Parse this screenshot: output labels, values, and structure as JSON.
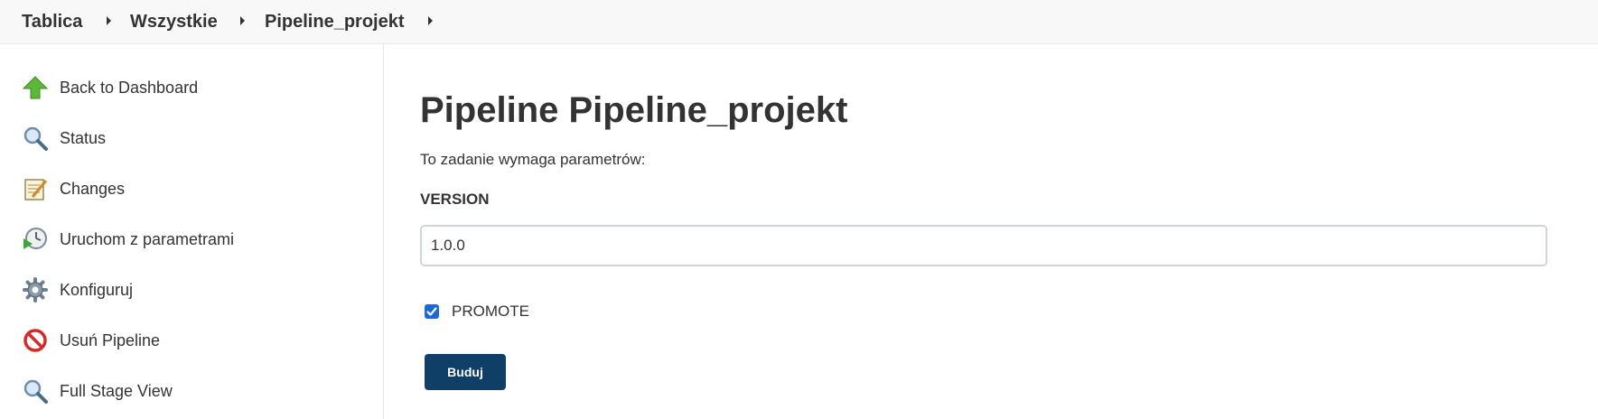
{
  "breadcrumb": {
    "items": [
      {
        "label": "Tablica"
      },
      {
        "label": "Wszystkie"
      },
      {
        "label": "Pipeline_projekt"
      }
    ]
  },
  "sidebar": {
    "items": [
      {
        "label": "Back to Dashboard",
        "icon": "up-arrow-icon"
      },
      {
        "label": "Status",
        "icon": "magnifier-icon"
      },
      {
        "label": "Changes",
        "icon": "notepad-icon"
      },
      {
        "label": "Uruchom z parametrami",
        "icon": "clock-play-icon"
      },
      {
        "label": "Konfiguruj",
        "icon": "gear-icon"
      },
      {
        "label": "Usuń Pipeline",
        "icon": "no-entry-icon"
      },
      {
        "label": "Full Stage View",
        "icon": "magnifier-icon"
      }
    ]
  },
  "main": {
    "title": "Pipeline Pipeline_projekt",
    "info": "To zadanie wymaga parametrów:",
    "version_param": {
      "name": "VERSION",
      "value": "1.0.0"
    },
    "promote_param": {
      "label": "PROMOTE",
      "checked": true
    },
    "build_label": "Buduj"
  },
  "colors": {
    "accent": "#0f3f66",
    "checkbox": "#1f67d2",
    "topbar": "#f8f8f8"
  }
}
